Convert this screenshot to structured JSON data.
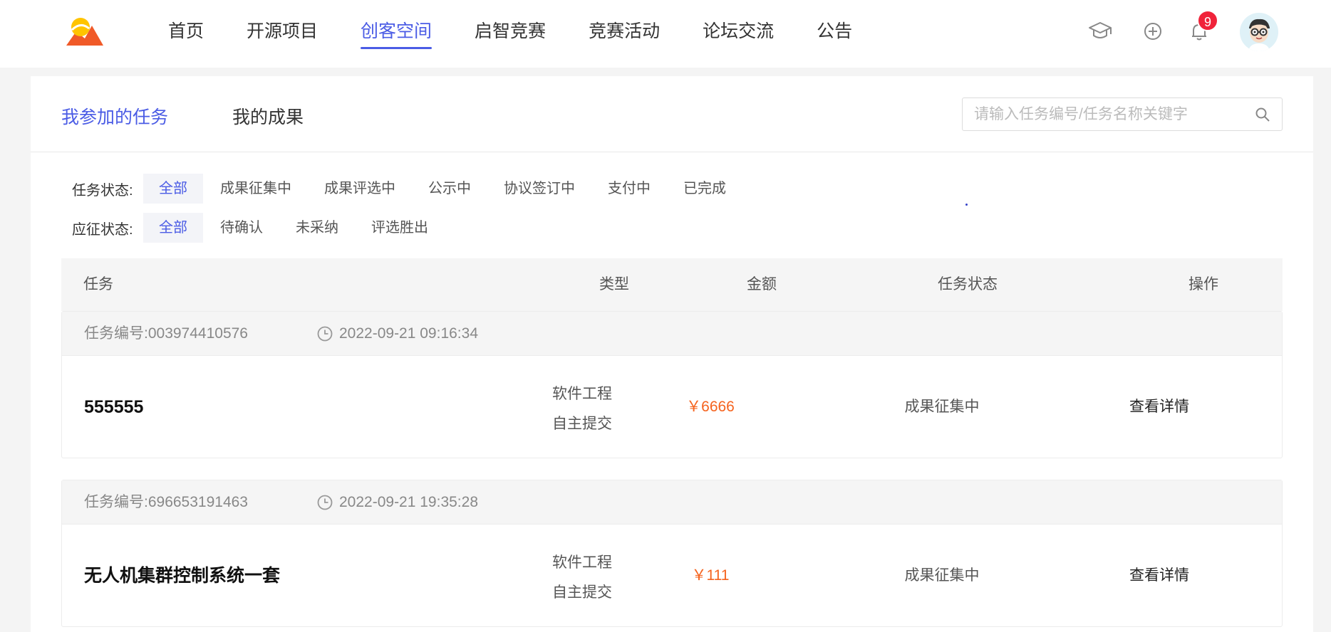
{
  "nav": {
    "items": [
      {
        "label": "首页"
      },
      {
        "label": "开源项目"
      },
      {
        "label": "创客空间"
      },
      {
        "label": "启智竞赛"
      },
      {
        "label": "竞赛活动"
      },
      {
        "label": "论坛交流"
      },
      {
        "label": "公告"
      }
    ],
    "active_index": 2,
    "notification_count": "9"
  },
  "tabs": {
    "participated": "我参加的任务",
    "results": "我的成果"
  },
  "search": {
    "placeholder": "请输入任务编号/任务名称关键字"
  },
  "filters": {
    "task_status": {
      "label": "任务状态:",
      "options": [
        "全部",
        "成果征集中",
        "成果评选中",
        "公示中",
        "协议签订中",
        "支付中",
        "已完成"
      ],
      "selected": "全部"
    },
    "bid_status": {
      "label": "应征状态:",
      "options": [
        "全部",
        "待确认",
        "未采纳",
        "评选胜出"
      ],
      "selected": "全部"
    }
  },
  "table": {
    "headers": {
      "task": "任务",
      "type": "类型",
      "amount": "金额",
      "status": "任务状态",
      "action": "操作"
    }
  },
  "tasks": [
    {
      "number": "任务编号:003974410576",
      "time": "2022-09-21 09:16:34",
      "name": "555555",
      "type_line1": "软件工程",
      "type_line2": "自主提交",
      "amount": "￥6666",
      "status": "成果征集中",
      "action": "查看详情"
    },
    {
      "number": "任务编号:696653191463",
      "time": "2022-09-21 19:35:28",
      "name": "无人机集群控制系统一套",
      "type_line1": "软件工程",
      "type_line2": "自主提交",
      "amount": "￥111",
      "status": "成果征集中",
      "action": "查看详情"
    }
  ],
  "colors": {
    "accent": "#4b5ce5",
    "amount": "#f5631e",
    "badge": "#f0233a"
  }
}
